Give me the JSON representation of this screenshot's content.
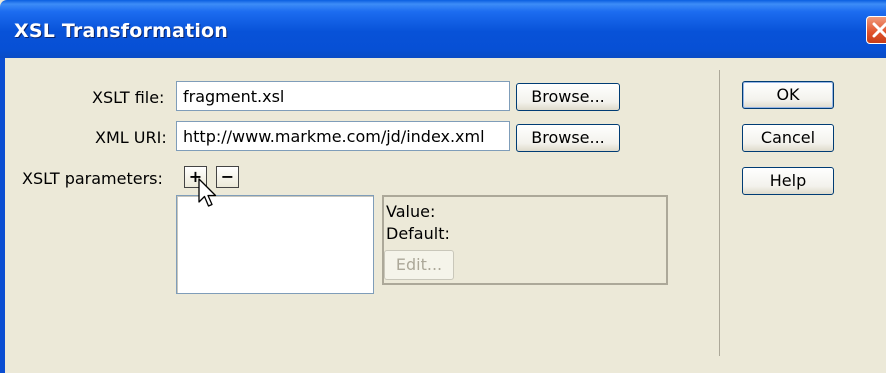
{
  "window": {
    "title": "XSL Transformation"
  },
  "form": {
    "xslt_file_label": "XSLT file:",
    "xslt_file_value": "fragment.xsl",
    "xml_uri_label": "XML URI:",
    "xml_uri_value": "http://www.markme.com/jd/index.xml",
    "browse_label": "Browse...",
    "params_label": "XSLT parameters:",
    "add_symbol": "+",
    "remove_symbol": "−"
  },
  "details": {
    "value_label": "Value:",
    "default_label": "Default:",
    "edit_label": "Edit..."
  },
  "buttons": {
    "ok": "OK",
    "cancel": "Cancel",
    "help": "Help"
  },
  "colors": {
    "titlebar": "#0852d8",
    "window_bg": "#ece9d8",
    "close_red": "#e0522b"
  },
  "icons": {
    "close": "close-icon",
    "cursor": "mouse-pointer-icon"
  }
}
